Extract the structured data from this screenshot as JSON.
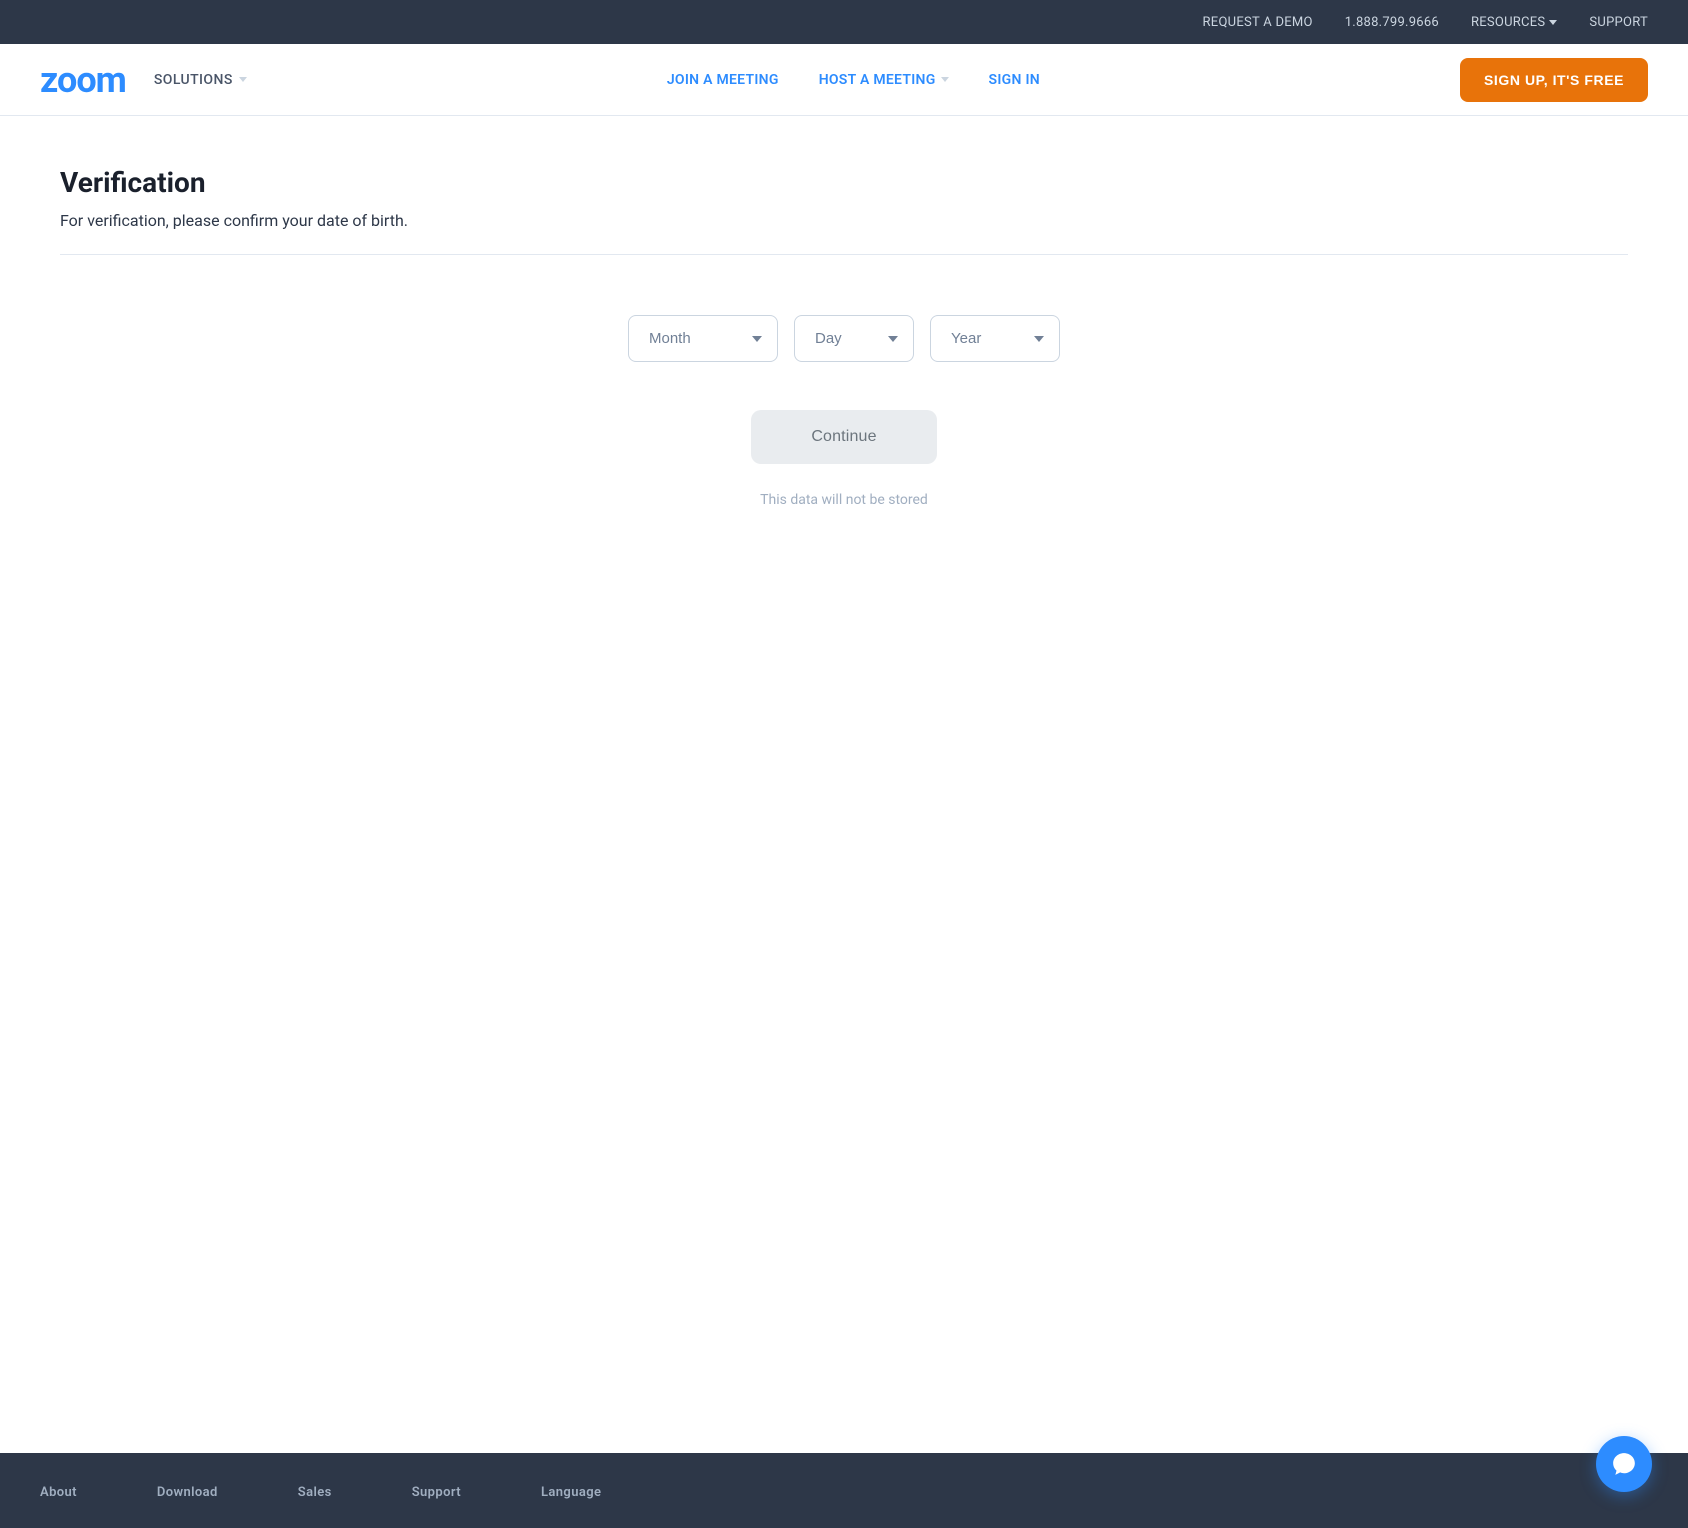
{
  "topBar": {
    "requestDemo": "REQUEST A DEMO",
    "phone": "1.888.799.9666",
    "resources": "RESOURCES",
    "support": "SUPPORT"
  },
  "nav": {
    "logo": "zoom",
    "solutions": "SOLUTIONS",
    "joinMeeting": "JOIN A MEETING",
    "hostMeeting": "HOST A MEETING",
    "signIn": "SIGN IN",
    "signUp": "SIGN UP, IT'S FREE"
  },
  "page": {
    "title": "Verification",
    "subtitle": "For verification, please confirm your date of birth."
  },
  "form": {
    "monthPlaceholder": "Month",
    "dayPlaceholder": "Day",
    "yearPlaceholder": "Year",
    "continueLabel": "Continue",
    "dataNote": "This data will not be stored"
  },
  "footer": {
    "cols": [
      {
        "title": "About"
      },
      {
        "title": "Download"
      },
      {
        "title": "Sales"
      },
      {
        "title": "Support"
      },
      {
        "title": "Language"
      }
    ]
  }
}
